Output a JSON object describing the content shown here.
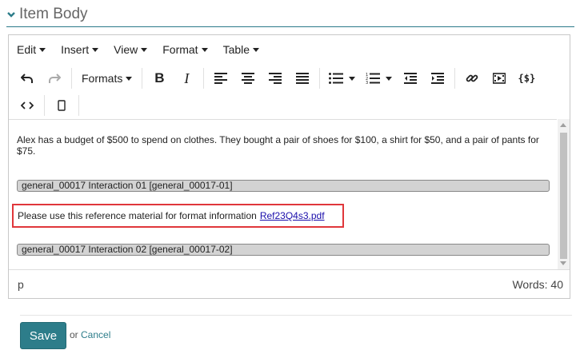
{
  "section": {
    "title": "Item Body"
  },
  "menubar": [
    {
      "label": "Edit"
    },
    {
      "label": "Insert"
    },
    {
      "label": "View"
    },
    {
      "label": "Format"
    },
    {
      "label": "Table"
    }
  ],
  "toolbar": {
    "formats_label": "Formats"
  },
  "content": {
    "paragraph": "Alex has a budget of $500 to spend on clothes. They bought a pair of shoes for $100, a shirt for $50, and a pair of pants for $75.",
    "interaction1": "general_00017 Interaction 01 [general_00017-01]",
    "reference_text": "Please use this reference material for format information",
    "reference_link": "Ref23Q4s3.pdf",
    "interaction2": "general_00017 Interaction 02 [general_00017-02]"
  },
  "statusbar": {
    "element_path": "p",
    "word_count": "Words: 40"
  },
  "footer": {
    "save_label": "Save",
    "or_text": "or",
    "cancel_label": "Cancel"
  },
  "colors": {
    "accent": "#2d7d8a",
    "highlight_border": "#e0373b",
    "link": "#1a0dab"
  }
}
